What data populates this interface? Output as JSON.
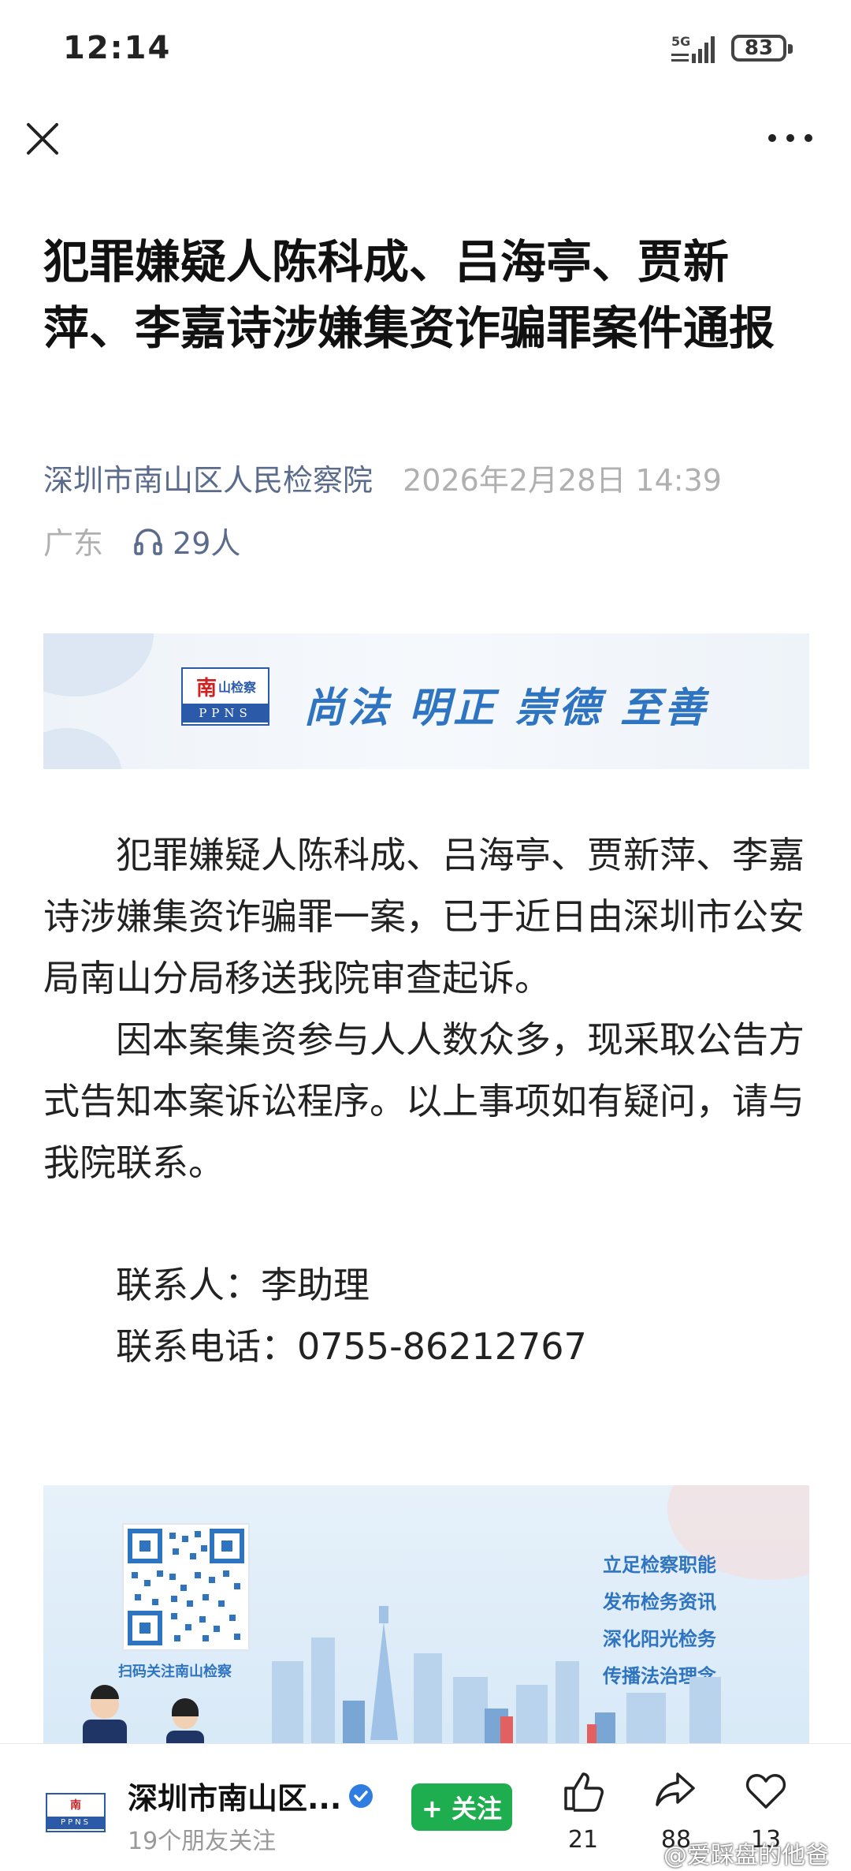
{
  "status_bar": {
    "time": "12:14",
    "network": "5G",
    "battery": "83"
  },
  "nav": {
    "close_icon": "close-icon",
    "more_icon": "more-icon"
  },
  "article": {
    "title": "犯罪嫌疑人陈科成、吕海亭、贾新萍、李嘉诗涉嫌集资诈骗罪案件通报",
    "author": "深圳市南山区人民检察院",
    "date": "2026年2月28日 14:39",
    "location": "广东",
    "listeners": "29人",
    "banner": {
      "logo_main": "南",
      "logo_sub": "山检察",
      "logo_en": "PPNS",
      "slogan": "尚法 明正 崇德 至善"
    },
    "paragraphs": [
      "犯罪嫌疑人陈科成、吕海亭、贾新萍、李嘉诗涉嫌集资诈骗罪一案，已于近日由深圳市公安局南山分局移送我院审查起诉。",
      "因本案集资参与人人数众多，现采取公告方式告知本案诉讼程序。以上事项如有疑问，请与我院联系。"
    ],
    "contact_person": "联系人：李助理",
    "contact_phone": "联系电话：0755-86212767",
    "poster": {
      "qr_caption": "扫码关注南山检察",
      "lines": [
        "立足检察职能",
        "发布检务资讯",
        "深化阳光检务",
        "传播法治理念"
      ]
    }
  },
  "bottom_bar": {
    "account_name": "深圳市南山区...",
    "friends": "19个朋友关注",
    "follow_label": "+ 关注",
    "likes": "21",
    "shares": "88",
    "favorites": "13",
    "watermark": "@爱踩盘的他爸"
  },
  "colors": {
    "accent_green": "#1fae4f",
    "link": "#5a6b8c",
    "brand_blue": "#2f74c0"
  }
}
